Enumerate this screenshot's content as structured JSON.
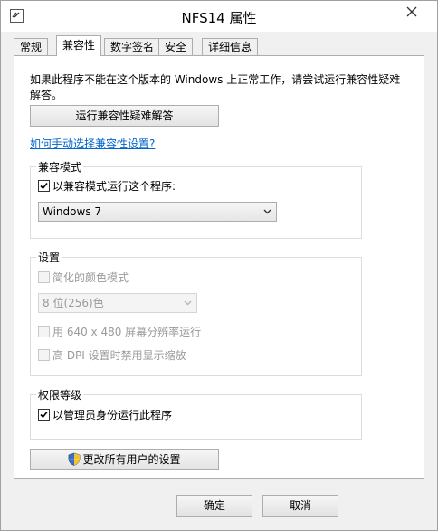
{
  "window": {
    "title": "NFS14 属性",
    "icons": {
      "app": "app-icon",
      "close": "close-icon"
    }
  },
  "tabs": [
    {
      "label": "常规",
      "active": false
    },
    {
      "label": "兼容性",
      "active": true
    },
    {
      "label": "数字签名",
      "active": false
    },
    {
      "label": "安全",
      "active": false
    },
    {
      "label": "详细信息",
      "active": false
    }
  ],
  "intro": "如果此程序不能在这个版本的 Windows 上正常工作，请尝试运行兼容性疑难解答。",
  "troubleshoot_button": "运行兼容性疑难解答",
  "help_link": "如何手动选择兼容性设置?",
  "compat_mode": {
    "title": "兼容模式",
    "checkbox_label": "以兼容模式运行这个程序:",
    "checked": true,
    "selected_os": "Windows 7"
  },
  "settings": {
    "title": "设置",
    "reduced_color": {
      "label": "简化的颜色模式",
      "checked": false,
      "enabled": false
    },
    "color_select": "8 位(256)色",
    "resolution": {
      "label": "用 640 x 480 屏幕分辨率运行",
      "checked": false,
      "enabled": false
    },
    "dpi": {
      "label": "高 DPI 设置时禁用显示缩放",
      "checked": false,
      "enabled": false
    }
  },
  "privilege": {
    "title": "权限等级",
    "admin_label": "以管理员身份运行此程序",
    "checked": true
  },
  "change_all_button": "更改所有用户的设置",
  "footer": {
    "ok": "确定",
    "cancel": "取消"
  },
  "colors": {
    "link": "#0066cc",
    "disabled_text": "#9a9a9a"
  }
}
